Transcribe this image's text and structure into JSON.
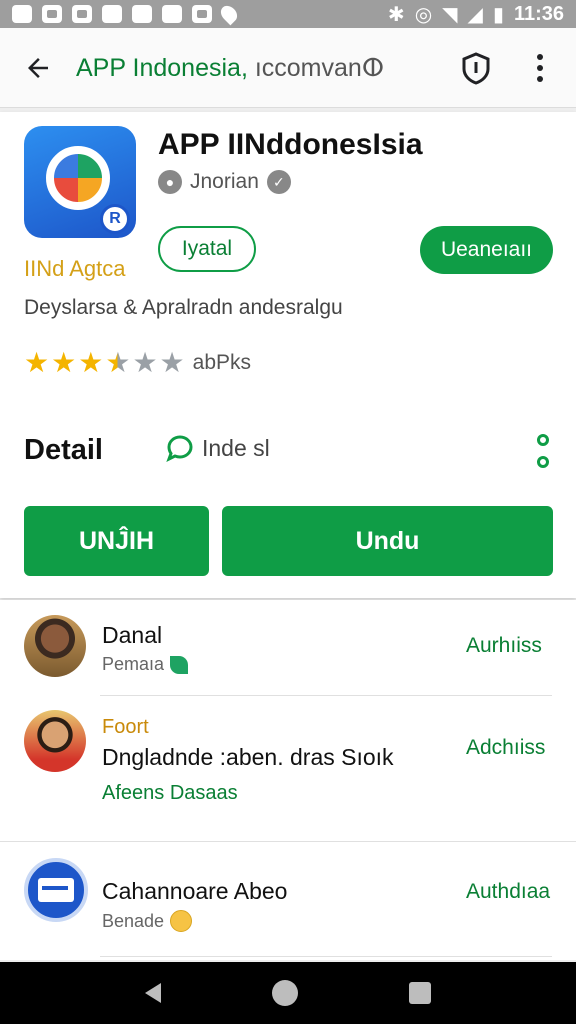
{
  "status_bar": {
    "time": "11:36"
  },
  "app_bar": {
    "url_highlight": "APP Indonesia,",
    "url_rest": " ıccomvanⵀ"
  },
  "app": {
    "title": "APP IINddonesIsia",
    "icon_badge": "R",
    "developer_tag": "IINd Agtca",
    "developer_name": "Jnorian",
    "outline_button": "Iyatal",
    "primary_button": "Ueaneıaıı",
    "description": "Deyslarsa  &  Apralradn andesralgu",
    "rating_value": 3.5,
    "rating_text": "abPks"
  },
  "detail": {
    "label": "Detail",
    "chat_text": "Inde sl"
  },
  "buttons": {
    "left": "UNĴIH",
    "right": "Undu"
  },
  "list": [
    {
      "name": "Danal",
      "sub": "Pemaıa",
      "action": "Aurhıiss"
    },
    {
      "name_top": "Foort",
      "name": "Dngladnde :aben. dras Sıoık",
      "sub": "Afeens Dasaas",
      "action": "Adchıiss"
    },
    {
      "name": "Cahannoare Abeo",
      "sub": "Benade",
      "action": "Authdıaa"
    }
  ]
}
